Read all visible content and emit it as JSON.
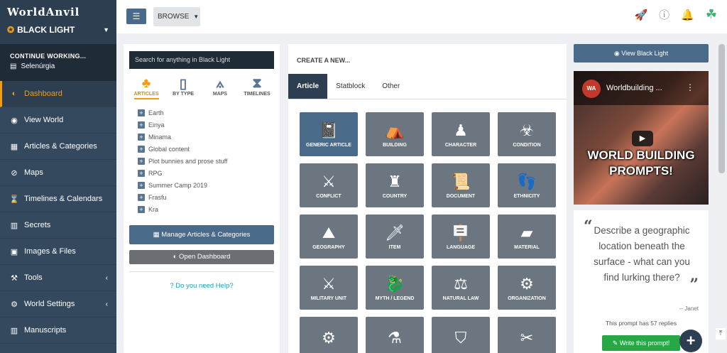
{
  "brand": {
    "logo": "WorldAnvil",
    "world_name": "BLACK LIGHT"
  },
  "continue": {
    "label": "CONTINUE WORKING...",
    "doc": "Selenúrgia"
  },
  "sidebar": {
    "items": [
      {
        "label": "Dashboard"
      },
      {
        "label": "View World"
      },
      {
        "label": "Articles & Categories"
      },
      {
        "label": "Maps"
      },
      {
        "label": "Timelines & Calendars"
      },
      {
        "label": "Secrets"
      },
      {
        "label": "Images & Files"
      },
      {
        "label": "Tools"
      },
      {
        "label": "World Settings"
      },
      {
        "label": "Manuscripts"
      }
    ]
  },
  "topbar": {
    "browse_label": "BROWSE"
  },
  "search": {
    "placeholder": "Search for anything in Black Light",
    "tabs": [
      {
        "label": "ARTICLES"
      },
      {
        "label": "BY TYPE"
      },
      {
        "label": "MAPS"
      },
      {
        "label": "TIMELINES"
      }
    ],
    "tree": [
      "Earth",
      "Einya",
      "Minama",
      "Global content",
      "Plot bunnies and prose stuff",
      "RPG",
      "Summer Camp 2019",
      "Frasfu",
      "Kra"
    ],
    "manage_label": "Manage Articles & Categories",
    "dashboard_label": "Open Dashboard",
    "help_label": "Do you need Help?"
  },
  "create": {
    "heading": "CREATE A NEW...",
    "tabs": [
      "Article",
      "Statblock",
      "Other"
    ],
    "tiles": [
      {
        "label": "GENERIC ARTICLE",
        "icon": "📓"
      },
      {
        "label": "BUILDING",
        "icon": "⛺"
      },
      {
        "label": "CHARACTER",
        "icon": "♟"
      },
      {
        "label": "CONDITION",
        "icon": "☣"
      },
      {
        "label": "CONFLICT",
        "icon": "⚔"
      },
      {
        "label": "COUNTRY",
        "icon": "♜"
      },
      {
        "label": "DOCUMENT",
        "icon": "📜"
      },
      {
        "label": "ETHNICITY",
        "icon": "👣"
      },
      {
        "label": "GEOGRAPHY",
        "icon": "⛰"
      },
      {
        "label": "ITEM",
        "icon": "🗡"
      },
      {
        "label": "LANGUAGE",
        "icon": "🪧"
      },
      {
        "label": "MATERIAL",
        "icon": "▰"
      },
      {
        "label": "MILITARY UNIT",
        "icon": "⚔"
      },
      {
        "label": "MYTH / LEGEND",
        "icon": "🐉"
      },
      {
        "label": "NATURAL LAW",
        "icon": "⚖"
      },
      {
        "label": "ORGANIZATION",
        "icon": "⚙"
      },
      {
        "label": "",
        "icon": "⚙"
      },
      {
        "label": "",
        "icon": "⚗"
      },
      {
        "label": "",
        "icon": "⛉"
      },
      {
        "label": "",
        "icon": "✂"
      }
    ]
  },
  "right": {
    "view_label": "View Black Light",
    "video": {
      "logo": "WA",
      "title": "Worldbuilding ...",
      "caption_line1": "WORLD BUILDING",
      "caption_line2": "PROMPTS!"
    },
    "prompt": {
      "text": "Describe a geographic location beneath the surface - what can you find lurking there?",
      "author": "-- Janet",
      "replies": "This prompt has 57 replies",
      "button": "Write this prompt!"
    }
  },
  "colors": {
    "accent": "#f39c12",
    "sidebar": "#34495e",
    "primary_button": "#4a6a8a",
    "success": "#28a745"
  }
}
